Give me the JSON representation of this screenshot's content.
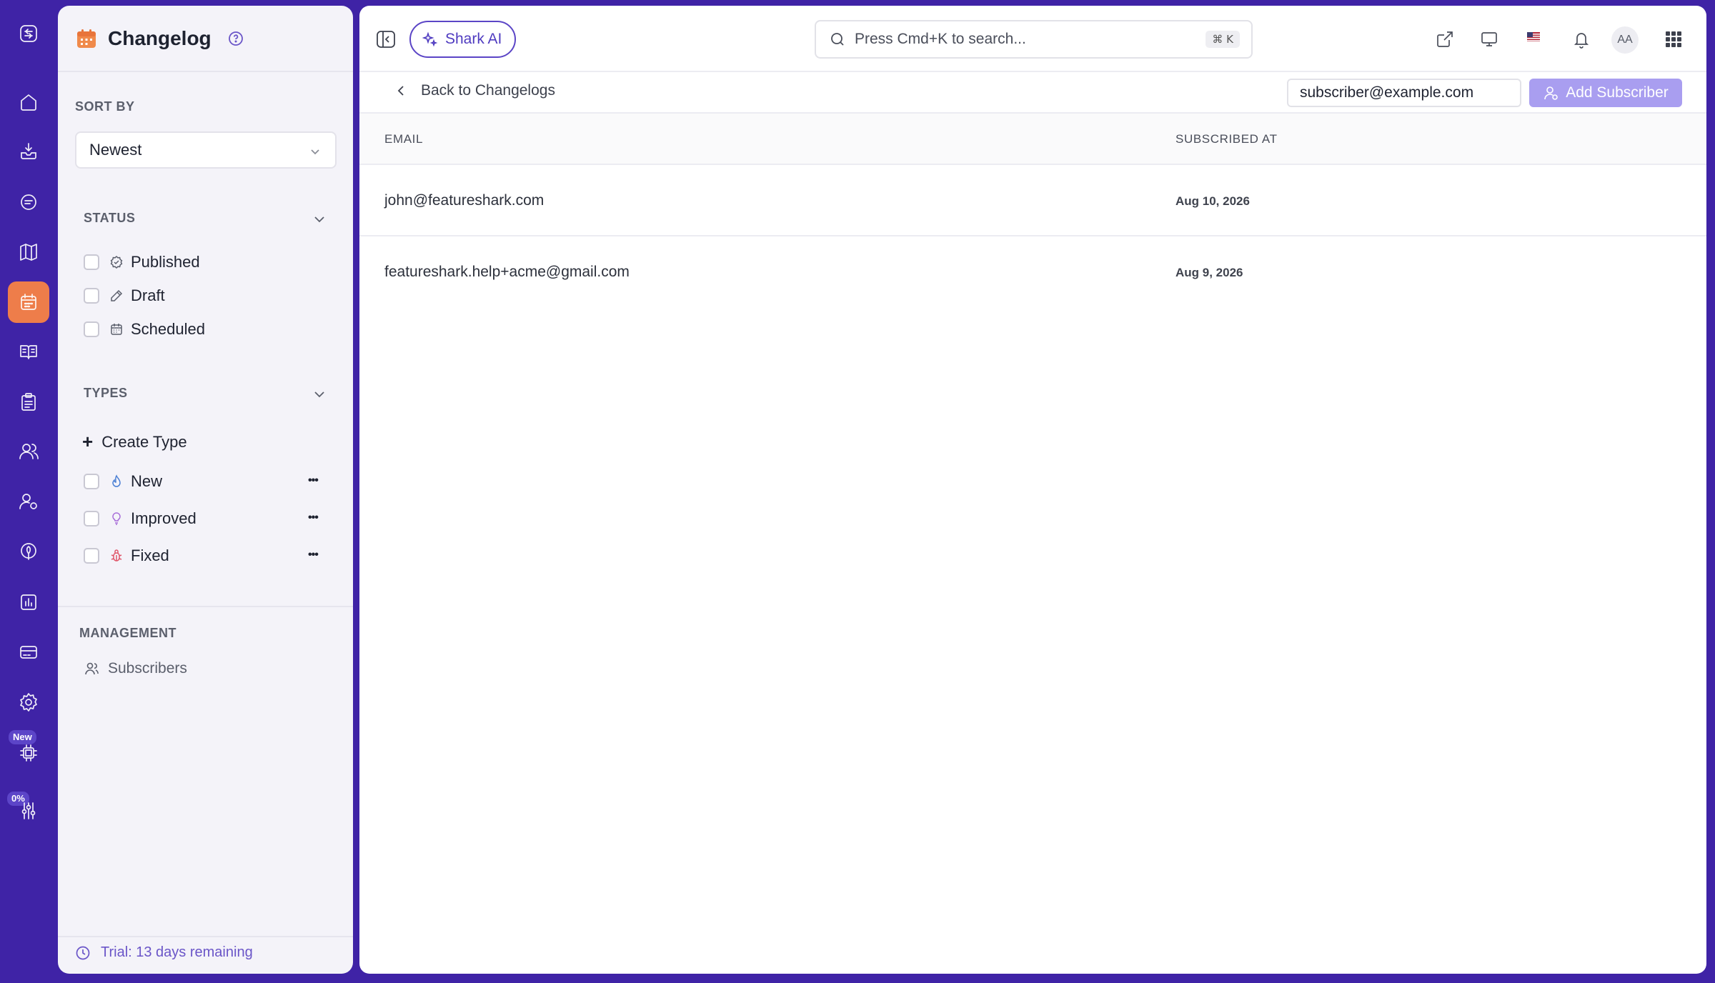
{
  "rail": {
    "items": [
      {
        "icon": "logo-icon"
      },
      {
        "icon": "home-icon"
      },
      {
        "icon": "inbox-icon"
      },
      {
        "icon": "chat-icon"
      },
      {
        "icon": "map-icon"
      },
      {
        "icon": "calendar-icon",
        "active": true
      },
      {
        "icon": "book-icon"
      },
      {
        "icon": "clipboard-icon"
      },
      {
        "icon": "users-icon"
      },
      {
        "icon": "user-settings-icon"
      },
      {
        "icon": "rocket-icon"
      },
      {
        "icon": "bar-chart-icon"
      },
      {
        "icon": "credit-card-icon"
      },
      {
        "icon": "gear-icon"
      },
      {
        "icon": "chip-icon"
      },
      {
        "icon": "sliders-icon"
      }
    ],
    "new_badge": "New",
    "progress_badge": "0%",
    "accent_color": "#ee7d4a",
    "background_color": "#3f23a6"
  },
  "panel": {
    "title": "Changelog",
    "sort_by_label": "SORT BY",
    "sort_value": "Newest",
    "status_label": "STATUS",
    "statuses": [
      {
        "label": "Published",
        "icon": "badge-check-icon"
      },
      {
        "label": "Draft",
        "icon": "pencil-icon"
      },
      {
        "label": "Scheduled",
        "icon": "calendar-small-icon"
      }
    ],
    "types_label": "TYPES",
    "create_type": "Create Type",
    "types": [
      {
        "label": "New",
        "icon": "flame-icon",
        "color": "#4a7fd4"
      },
      {
        "label": "Improved",
        "icon": "lightbulb-icon",
        "color": "#a66ad8"
      },
      {
        "label": "Fixed",
        "icon": "bug-icon",
        "color": "#e0566a"
      }
    ],
    "more_label": "•••",
    "management_label": "MANAGEMENT",
    "subscribers_link": "Subscribers",
    "trial_text": "Trial: 13 days remaining"
  },
  "topbar": {
    "shark_ai": "Shark AI",
    "search_placeholder": "Press Cmd+K to search...",
    "search_shortcut": "⌘ K",
    "avatar_initials": "AA"
  },
  "subbar": {
    "back_label": "Back to Changelogs",
    "subscriber_input_value": "subscriber@example.com",
    "add_button": "Add Subscriber"
  },
  "table": {
    "columns": [
      "EMAIL",
      "SUBSCRIBED AT"
    ],
    "rows": [
      {
        "email": "john@featureshark.com",
        "subscribed_at": "Aug 10, 2026"
      },
      {
        "email": "featureshark.help+acme@gmail.com",
        "subscribed_at": "Aug 9, 2026"
      }
    ]
  }
}
